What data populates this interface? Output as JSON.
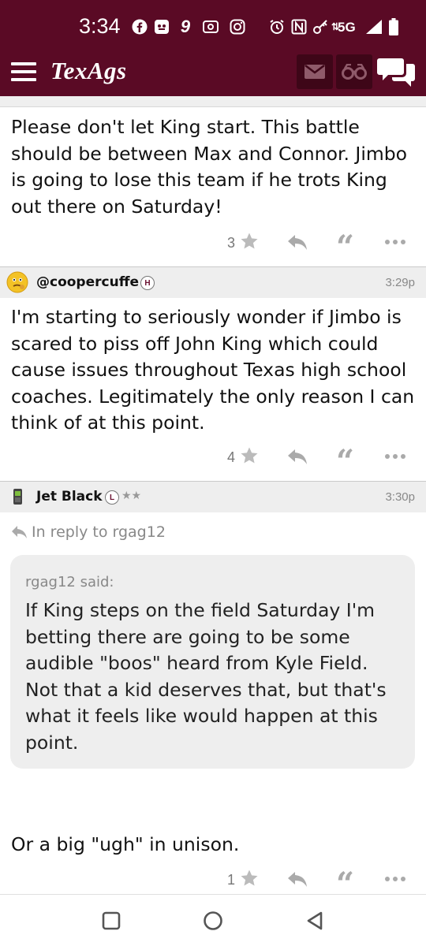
{
  "status_bar": {
    "time": "3:34",
    "network": "5G",
    "icons": [
      "facebook-icon",
      "app-icon",
      "app-nine-icon",
      "app-icon",
      "instagram-icon",
      "alarm-icon",
      "nfc-icon",
      "vpn-key-icon",
      "data-arrows-icon",
      "signal-icon",
      "battery-icon"
    ]
  },
  "app_bar": {
    "logo": "TexAgs",
    "buttons": [
      "mail-icon",
      "binoculars-icon",
      "chat-bubbles-icon"
    ]
  },
  "posts": [
    {
      "text": "Please don't let King start. This battle should be between Max and Connor. Jimbo is going to lose this team if he trots King out there on Saturday!",
      "stars": "3"
    },
    {
      "username": "@coopercuffe",
      "badge": "H",
      "time": "3:29p",
      "text": "I'm starting to seriously wonder if Jimbo is scared to piss off John King which could cause issues throughout Texas high school coaches. Legitimately the only reason I can think of at this point.",
      "stars": "4"
    },
    {
      "username": "Jet Black",
      "badge": "L",
      "rank": "★★",
      "time": "3:30p",
      "reply_to": "In reply to rgag12",
      "quote_author": "rgag12 said:",
      "quote_text": "If King steps on the field Saturday I'm betting there are going to be some audible \"boos\" heard from Kyle Field. Not that a kid deserves that, but that's what it feels like would happen at this point.",
      "text": "Or a big \"ugh\" in unison.",
      "stars": "1"
    }
  ],
  "colors": {
    "brand": "#5a0a25",
    "header_button": "#3e0618",
    "post_header_bg": "#eeeeee",
    "muted": "#888888"
  }
}
